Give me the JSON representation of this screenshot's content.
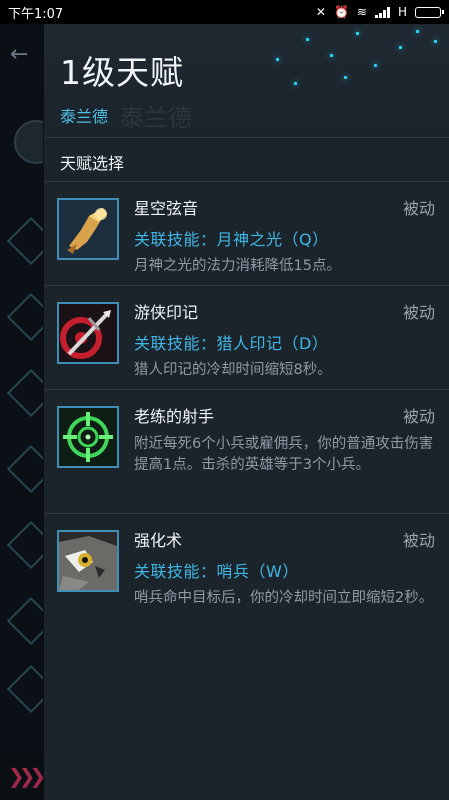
{
  "status_bar": {
    "time": "下午1:07",
    "network": "H"
  },
  "drawer": {
    "title": "1级天赋",
    "hero_name": "泰兰德",
    "ghost_hero_name": "泰兰德",
    "section_title": "天赋选择",
    "talents": [
      {
        "name": "星空弦音",
        "type": "被动",
        "skill": "关联技能：月神之光（Q）",
        "description": "月神之光的法力消耗降低15点。",
        "icon": "starlight-hand-icon"
      },
      {
        "name": "游侠印记",
        "type": "被动",
        "skill": "关联技能：猎人印记（D）",
        "description": "猎人印记的冷却时间缩短8秒。",
        "icon": "ranger-mark-icon"
      },
      {
        "name": "老练的射手",
        "type": "被动",
        "skill": "",
        "description": "附近每死6个小兵或雇佣兵，你的普通攻击伤害提高1点。击杀的英雄等于3个小兵。",
        "icon": "crosshair-icon"
      },
      {
        "name": "强化术",
        "type": "被动",
        "skill": "关联技能：哨兵（W）",
        "description": "哨兵命中目标后，你的冷却时间立即缩短2秒。",
        "icon": "owl-icon"
      }
    ]
  },
  "colors": {
    "accent": "#3fb7e6",
    "drawer_bg": "#1b232b",
    "muted_text": "#8f9aa5"
  }
}
